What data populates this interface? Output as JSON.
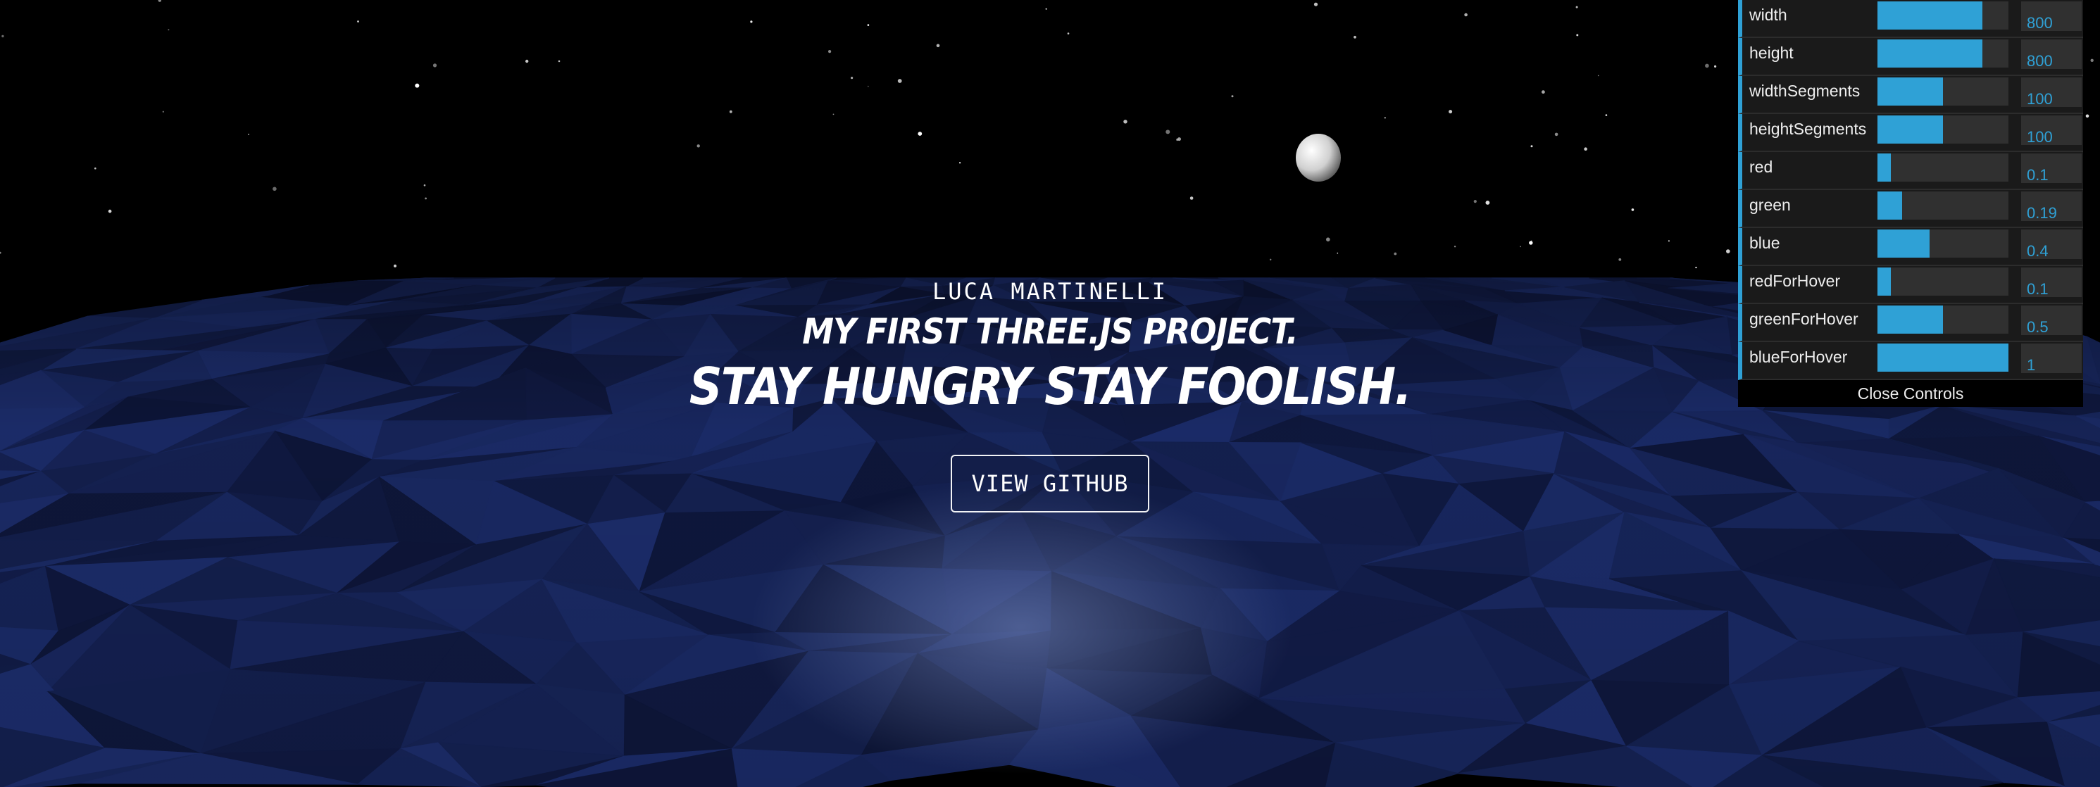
{
  "hero": {
    "author": "LUCA MARTINELLI",
    "subtitle": "MY FIRST THREE.JS PROJECT.",
    "headline": "STAY HUNGRY STAY FOOLISH.",
    "cta_label": "VIEW GITHUB"
  },
  "controls": {
    "items": [
      {
        "label": "width",
        "value": "800",
        "fill": 0.8
      },
      {
        "label": "height",
        "value": "800",
        "fill": 0.8
      },
      {
        "label": "widthSegments",
        "value": "100",
        "fill": 0.5
      },
      {
        "label": "heightSegments",
        "value": "100",
        "fill": 0.5
      },
      {
        "label": "red",
        "value": "0.1",
        "fill": 0.1
      },
      {
        "label": "green",
        "value": "0.19",
        "fill": 0.19
      },
      {
        "label": "blue",
        "value": "0.4",
        "fill": 0.4
      },
      {
        "label": "redForHover",
        "value": "0.1",
        "fill": 0.1
      },
      {
        "label": "greenForHover",
        "value": "0.5",
        "fill": 0.5
      },
      {
        "label": "blueForHover",
        "value": "1",
        "fill": 1.0
      }
    ],
    "close_label": "Close Controls"
  },
  "colors": {
    "sky": "#000000",
    "plane_base": "#1a2a55",
    "gui_accent": "#2fa1d6",
    "gui_bg": "#1a1a1a"
  }
}
